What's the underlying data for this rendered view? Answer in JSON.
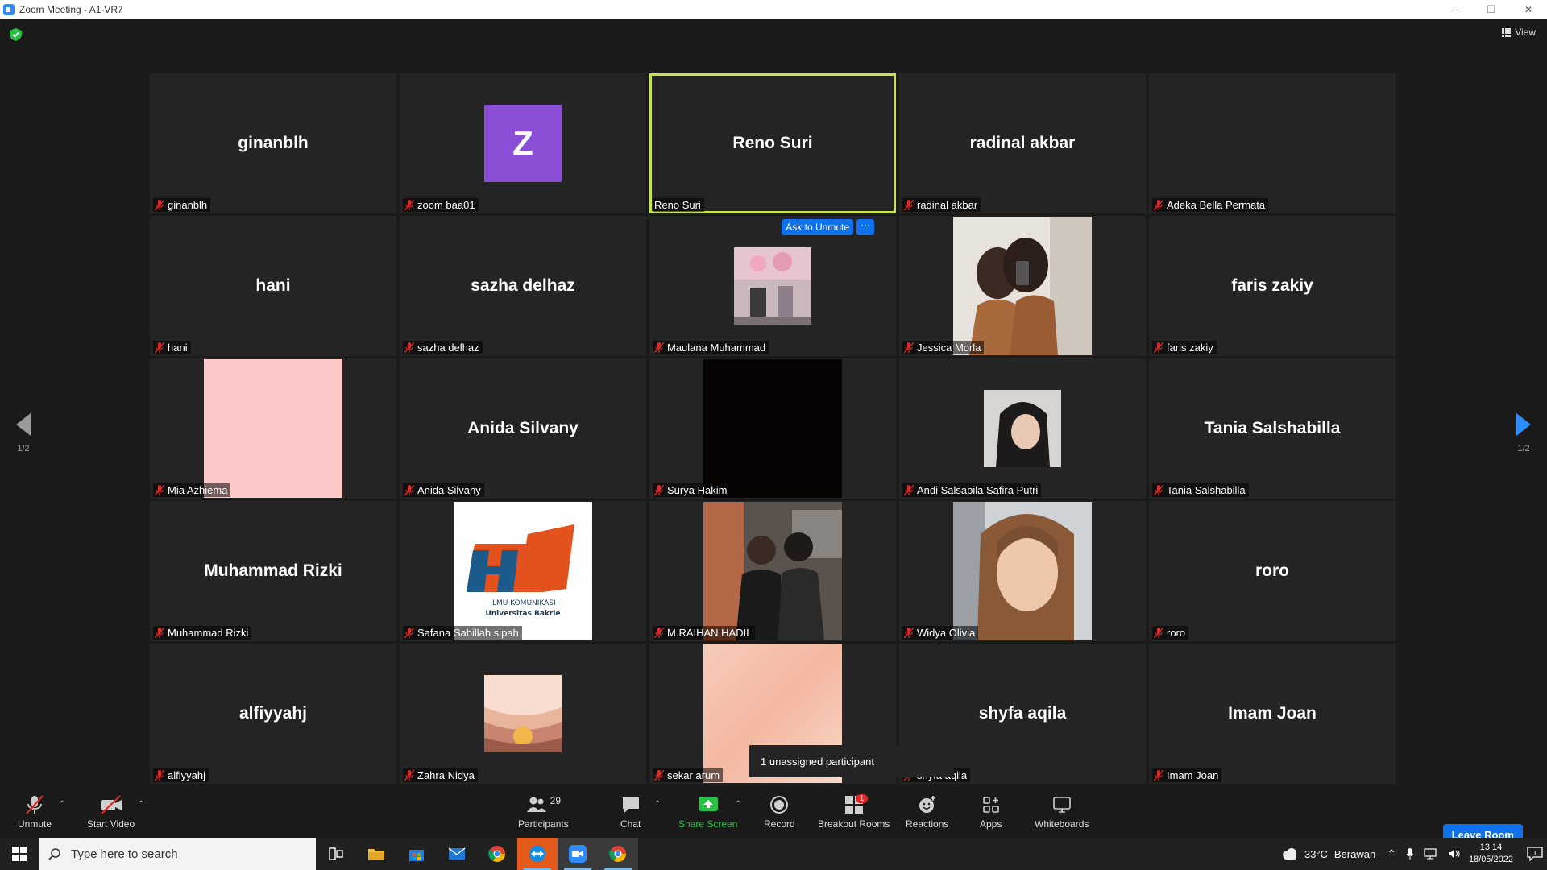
{
  "window": {
    "title": "Zoom Meeting - A1-VR7",
    "minimize": "─",
    "restore": "❐",
    "close": "✕"
  },
  "view_label": "View",
  "gallery": {
    "tiles": [
      {
        "big": "ginanblh",
        "label": "ginanblh"
      },
      {
        "big": "",
        "avatar": "Z",
        "label": "zoom baa01"
      },
      {
        "big": "Reno Suri",
        "label": "Reno Suri"
      },
      {
        "big": "radinal akbar",
        "label": "radinal akbar"
      },
      {
        "big": "",
        "label": "Adeka Bella Permata"
      },
      {
        "big": "hani",
        "label": "hani"
      },
      {
        "big": "sazha delhaz",
        "label": "sazha delhaz"
      },
      {
        "big": "",
        "label": "Maulana Muhammad"
      },
      {
        "big": "",
        "label": "Jessica Morla"
      },
      {
        "big": "faris zakiy",
        "label": "faris zakiy"
      },
      {
        "big": "",
        "label": "Mia Azhiema"
      },
      {
        "big": "Anida Silvany",
        "label": "Anida Silvany"
      },
      {
        "big": "",
        "label": "Surya Hakim"
      },
      {
        "big": "",
        "label": "Andi Salsabila Safira Putri"
      },
      {
        "big": "Tania Salshabilla",
        "label": "Tania Salshabilla"
      },
      {
        "big": "Muhammad Rizki",
        "label": "Muhammad Rizki"
      },
      {
        "big": "",
        "label": "Safana Sabillah sipah",
        "logo_line1": "ILMU KOMUNIKASI",
        "logo_line2": "Universitas Bakrie"
      },
      {
        "big": "",
        "label": "M.RAIHAN HADIL"
      },
      {
        "big": "",
        "label": "Widya Olivia"
      },
      {
        "big": "roro",
        "label": "roro"
      },
      {
        "big": "alfiyyahj",
        "label": "alfiyyahj"
      },
      {
        "big": "",
        "label": "Zahra Nidya"
      },
      {
        "big": "",
        "label": "sekar arum"
      },
      {
        "big": "shyfa aqila",
        "label": "shyfa aqila"
      },
      {
        "big": "Imam Joan",
        "label": "Imam Joan"
      }
    ],
    "ask_unmute": "Ask to Unmute",
    "more": "···"
  },
  "pagination": {
    "left": "1/2",
    "right": "1/2"
  },
  "tooltip": "1 unassigned participant",
  "toolbar": {
    "unmute": "Unmute",
    "start_video": "Start Video",
    "participants": "Participants",
    "participants_count": "29",
    "chat": "Chat",
    "share_screen": "Share Screen",
    "record": "Record",
    "breakout_rooms": "Breakout Rooms",
    "breakout_badge": "1",
    "reactions": "Reactions",
    "apps": "Apps",
    "whiteboards": "Whiteboards",
    "leave_room": "Leave Room"
  },
  "taskbar": {
    "search_placeholder": "Type here to search",
    "weather_temp": "33°C",
    "weather_desc": "Berawan",
    "time": "13:14",
    "date": "18/05/2022",
    "notif_count": "1"
  },
  "colors": {
    "accent": "#0e72ed",
    "active_speaker": "#c6e44a",
    "mic_off": "#e02828",
    "share_green": "#26c145"
  }
}
